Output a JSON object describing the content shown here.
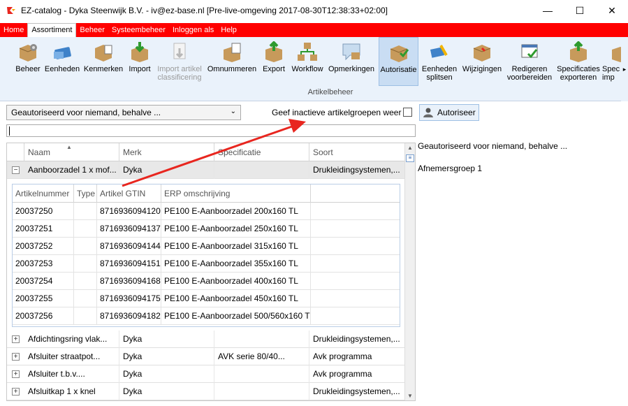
{
  "window": {
    "title": "EZ-catalog - Dyka Steenwijk B.V. - iv@ez-base.nl [Pre-live-omgeving 2017-08-30T12:38:33+02:00]",
    "minimize": "—",
    "maximize": "☐",
    "close": "✕"
  },
  "menu": [
    "Home",
    "Assortiment",
    "Beheer",
    "Systeembeheer",
    "Inloggen als",
    "Help"
  ],
  "ribbon": {
    "group_label": "Artikelbeheer",
    "buttons": [
      {
        "label": "Beheer",
        "icon": "box-gear-icon"
      },
      {
        "label": "Eenheden",
        "icon": "units-icon"
      },
      {
        "label": "Kenmerken",
        "icon": "properties-icon"
      },
      {
        "label": "Import",
        "icon": "import-icon"
      },
      {
        "label": "Import artikel",
        "label2": "classificering",
        "icon": "import-classification-icon",
        "disabled": true
      },
      {
        "label": "Omnummeren",
        "icon": "renumber-icon"
      },
      {
        "label": "Export",
        "icon": "export-icon"
      },
      {
        "label": "Workflow",
        "icon": "workflow-icon"
      },
      {
        "label": "Opmerkingen",
        "icon": "comments-icon"
      },
      {
        "label": "Autorisatie",
        "icon": "authorization-icon",
        "selected": true
      },
      {
        "label": "Eenheden",
        "label2": "splitsen",
        "icon": "split-units-icon"
      },
      {
        "label": "Wijzigingen",
        "icon": "changes-icon"
      },
      {
        "label": "Redigeren",
        "label2": "voorbereiden",
        "icon": "edit-prepare-icon"
      },
      {
        "label": "Specificaties",
        "label2": "exporteren",
        "icon": "export-specs-icon"
      },
      {
        "label": "Spec",
        "label2": "imp",
        "icon": "import-specs-icon"
      }
    ]
  },
  "toolbar": {
    "dropdown_value": "Geautoriseerd voor niemand, behalve ...",
    "inactive_label": "Geef inactieve artikelgroepen weer",
    "inactive_checked": false,
    "autoriseer_label": "Autoriseer"
  },
  "search": {
    "value": ""
  },
  "grid": {
    "columns": [
      "Naam",
      "Merk",
      "Specificatie",
      "Soort"
    ],
    "expanded_row": {
      "naam": "Aanboorzadel 1 x mof...",
      "merk": "Dyka",
      "spec": "",
      "soort": "Drukleidingsystemen,..."
    },
    "subgrid": {
      "columns": [
        "Artikelnummer",
        "Type",
        "Artikel GTIN",
        "ERP omschrijving",
        ""
      ],
      "rows": [
        [
          "20037250",
          "",
          "8716936094120",
          "PE100 E-Aanboorzadel 200x160 TL"
        ],
        [
          "20037251",
          "",
          "8716936094137",
          "PE100 E-Aanboorzadel 250x160 TL"
        ],
        [
          "20037252",
          "",
          "8716936094144",
          "PE100 E-Aanboorzadel 315x160 TL"
        ],
        [
          "20037253",
          "",
          "8716936094151",
          "PE100 E-Aanboorzadel 355x160 TL"
        ],
        [
          "20037254",
          "",
          "8716936094168",
          "PE100 E-Aanboorzadel 400x160 TL"
        ],
        [
          "20037255",
          "",
          "8716936094175",
          "PE100 E-Aanboorzadel 450x160 TL"
        ],
        [
          "20037256",
          "",
          "8716936094182",
          "PE100 E-Aanboorzadel 500/560x160 TL"
        ]
      ]
    },
    "rows": [
      {
        "naam": "Afdichtingsring vlak...",
        "merk": "Dyka",
        "spec": "",
        "soort": "Drukleidingsystemen,..."
      },
      {
        "naam": "Afsluiter straatpot...",
        "merk": "Dyka",
        "spec": "AVK serie 80/40...",
        "soort": "Avk programma"
      },
      {
        "naam": "Afsluiter t.b.v....",
        "merk": "Dyka",
        "spec": "",
        "soort": "Avk programma"
      },
      {
        "naam": "Afsluitkap 1 x knel",
        "merk": "Dyka",
        "spec": "",
        "soort": "Drukleidingsystemen,..."
      }
    ]
  },
  "right_panel": [
    "Geautoriseerd voor niemand, behalve ...",
    "Afnemersgroep 1"
  ],
  "colors": {
    "menubar": "#ff0000",
    "ribbon_bg": "#eaf2fb",
    "annotation_arrow": "#e8261f"
  }
}
